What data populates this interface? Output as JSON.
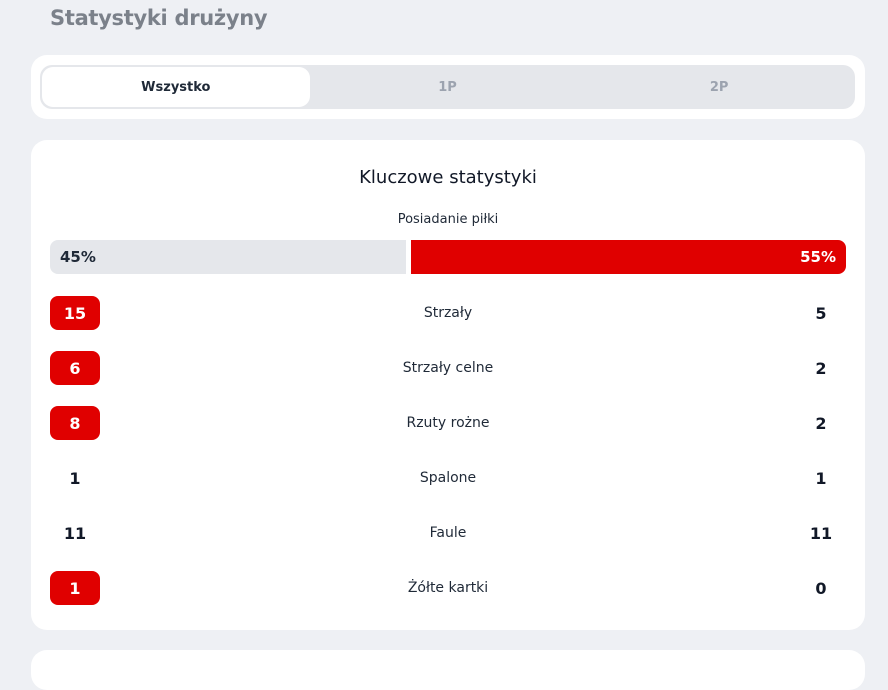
{
  "page_title": "Statystyki drużyny",
  "tabs": [
    {
      "label": "Wszystko",
      "active": true
    },
    {
      "label": "1P",
      "active": false
    },
    {
      "label": "2P",
      "active": false
    }
  ],
  "key_stats": {
    "title": "Kluczowe statystyki",
    "possession": {
      "label": "Posiadanie piłki",
      "home": "45%",
      "away": "55%",
      "home_value": 45,
      "away_value": 55
    },
    "rows": [
      {
        "label": "Strzały",
        "home": "15",
        "away": "5",
        "highlight": "home"
      },
      {
        "label": "Strzały celne",
        "home": "6",
        "away": "2",
        "highlight": "home"
      },
      {
        "label": "Rzuty rożne",
        "home": "8",
        "away": "2",
        "highlight": "home"
      },
      {
        "label": "Spalone",
        "home": "1",
        "away": "1",
        "highlight": "none"
      },
      {
        "label": "Faule",
        "home": "11",
        "away": "11",
        "highlight": "none"
      },
      {
        "label": "Żółte kartki",
        "home": "1",
        "away": "0",
        "highlight": "home"
      }
    ]
  },
  "colors": {
    "accent": "#e00000",
    "track": "#e5e7eb",
    "background": "#eef0f4"
  }
}
